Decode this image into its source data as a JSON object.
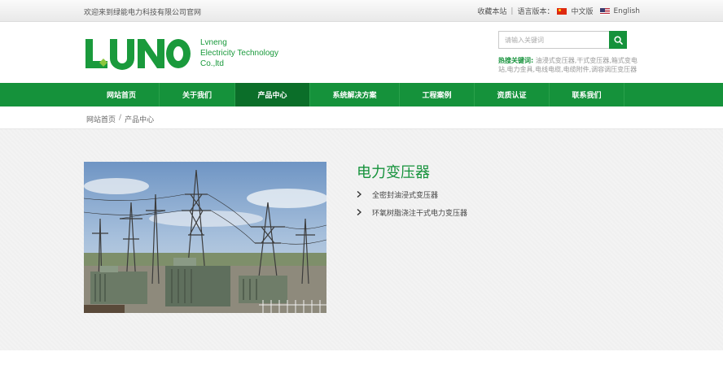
{
  "topbar": {
    "welcome": "欢迎来到绿能电力科技有限公司官网",
    "bookmark": "收藏本站",
    "separator": "|",
    "language_label": "语言版本：",
    "lang_cn": "中文版",
    "lang_en": "English"
  },
  "header": {
    "logo_alt": "LUNO",
    "company_line1": "Lvneng",
    "company_line2": "Electricity Technology",
    "company_line3": "Co.,ltd",
    "search_placeholder": "请输入关键词",
    "hot_label": "热搜关键词:",
    "hot_keywords": " 油浸式变压器,干式变压器,箱式变电站,电力金具,电线电缆,电缆附件,调容调压变压器"
  },
  "nav": {
    "items": [
      {
        "label": "网站首页"
      },
      {
        "label": "关于我们"
      },
      {
        "label": "产品中心"
      },
      {
        "label": "系统解决方案"
      },
      {
        "label": "工程案例"
      },
      {
        "label": "资质认证"
      },
      {
        "label": "联系我们"
      }
    ],
    "active_index": 2
  },
  "breadcrumb": {
    "home": "网站首页",
    "separator": "/",
    "current": "产品中心"
  },
  "product": {
    "title": "电力变压器",
    "items": [
      {
        "label": "全密封油浸式变压器"
      },
      {
        "label": "环氧树脂浇注干式电力变压器"
      }
    ]
  },
  "colors": {
    "brand_green": "#15923b",
    "nav_active": "#0b6e29"
  },
  "icons": {
    "search": "search-icon",
    "list_arrow": "chevron-right-icon",
    "flag_cn": "china-flag-icon",
    "flag_us": "us-flag-icon"
  }
}
